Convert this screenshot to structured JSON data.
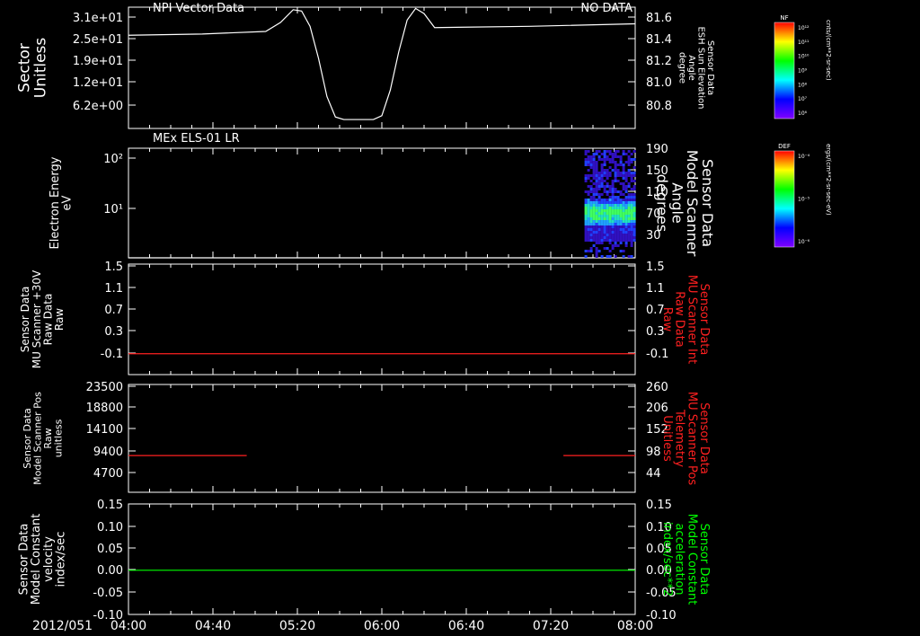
{
  "chart_data": [
    {
      "type": "line",
      "title": "NPI Vector Data",
      "status": "NO DATA",
      "ylabel_left": [
        "Sector",
        "Unitless"
      ],
      "ylabel_right": [
        "Sensor Data",
        "ESH Sun Elevation",
        "Angle",
        "degree"
      ],
      "yticks_left": [
        "3.1e+01",
        "2.5e+01",
        "1.9e+01",
        "1.2e+01",
        "6.2e+00"
      ],
      "yticks_right": [
        "81.6",
        "81.4",
        "81.2",
        "81.0",
        "80.8"
      ],
      "ylim_right": [
        80.65,
        81.6
      ],
      "color": "#ffffff",
      "series": [
        {
          "axis": "right",
          "points": [
            [
              0,
              81.38
            ],
            [
              35,
              81.39
            ],
            [
              65,
              81.41
            ],
            [
              72,
              81.48
            ],
            [
              78,
              81.58
            ],
            [
              82,
              81.57
            ],
            [
              86,
              81.45
            ],
            [
              90,
              81.2
            ],
            [
              94,
              80.9
            ],
            [
              98,
              80.74
            ],
            [
              102,
              80.72
            ],
            [
              116,
              80.72
            ],
            [
              120,
              80.75
            ],
            [
              124,
              80.95
            ],
            [
              128,
              81.25
            ],
            [
              132,
              81.5
            ],
            [
              136,
              81.59
            ],
            [
              140,
              81.55
            ],
            [
              145,
              81.44
            ],
            [
              190,
              81.45
            ],
            [
              240,
              81.47
            ]
          ]
        }
      ]
    },
    {
      "type": "heatmap",
      "title": "MEx ELS-01 LR",
      "ylabel_left": [
        "Electron Energy",
        "eV"
      ],
      "ylabel_right": [
        "Sensor Data",
        "Model Scanner",
        "Angle",
        "degrees"
      ],
      "yticks_left": [
        "10²",
        "10¹"
      ],
      "yticks_right": [
        "190",
        "150",
        "110",
        "70",
        "30"
      ],
      "ylim_right": [
        10,
        190
      ],
      "scanner_angle": 10,
      "data_start_min": 216,
      "color": "#ffffff"
    },
    {
      "type": "line",
      "ylabel_left": [
        "Sensor Data",
        "MU Scanner +30V",
        "Raw Data",
        "Raw"
      ],
      "ylabel_right": [
        "Sensor Data",
        "MU Scanner Int",
        "Raw Data",
        "Raw"
      ],
      "yticks_left": [
        "1.5",
        "1.1",
        "0.7",
        "0.3",
        "-0.1"
      ],
      "yticks_right": [
        "1.5",
        "1.1",
        "0.7",
        "0.3",
        "-0.1"
      ],
      "ylim": [
        -0.35,
        1.5
      ],
      "right_label_color": "#ff2020",
      "color": "#ff2020",
      "series": [
        {
          "axis": "right",
          "points": [
            [
              0,
              0.0
            ],
            [
              240,
              0.0
            ]
          ]
        }
      ]
    },
    {
      "type": "line",
      "ylabel_left": [
        "Sensor Data",
        "Model Scanner Pos",
        "Raw",
        "unitless"
      ],
      "ylabel_right": [
        "Sensor Data",
        "MU Scanner Pos",
        "Telemetry",
        "Unitless"
      ],
      "yticks_left": [
        "23500",
        "18800",
        "14100",
        "9400",
        "4700"
      ],
      "yticks_right": [
        "260",
        "206",
        "152",
        "98",
        "44"
      ],
      "ylim_left": [
        0,
        23500
      ],
      "right_label_color": "#ff2020",
      "color": "#ff2020",
      "series": [
        {
          "axis": "left",
          "points": [
            [
              0,
              8000
            ],
            [
              56,
              8000
            ]
          ]
        },
        {
          "axis": "left",
          "points": [
            [
              206,
              8000
            ],
            [
              240,
              8000
            ]
          ]
        }
      ]
    },
    {
      "type": "line",
      "ylabel_left": [
        "Sensor Data",
        "Model Constant",
        "velocity",
        "index/sec"
      ],
      "ylabel_right": [
        "Sensor Data",
        "Model Constant",
        "acceleration",
        "index/sec**2"
      ],
      "yticks_left": [
        "0.15",
        "0.10",
        "0.05",
        "0.00",
        "-0.05",
        "-0.10"
      ],
      "yticks_right": [
        "0.15",
        "0.10",
        "0.05",
        "0.00",
        "-0.05",
        "-0.10"
      ],
      "ylim": [
        -0.1,
        0.15
      ],
      "right_label_color": "#00ff00",
      "color": "#00ff00",
      "series": [
        {
          "axis": "left",
          "points": [
            [
              0,
              0.0
            ],
            [
              240,
              0.0
            ]
          ]
        }
      ]
    }
  ],
  "time_axis": {
    "date": "2012/051",
    "ticks": [
      "04:00",
      "04:40",
      "05:20",
      "06:00",
      "06:40",
      "07:20",
      "08:00"
    ],
    "xlim_minutes": [
      0,
      240
    ]
  },
  "colorbars": [
    {
      "label": "NF",
      "units": "cnts/(cm**2-sr-sec)",
      "ticks": [
        "10¹²",
        "10¹¹",
        "10¹⁰",
        "10⁹",
        "10⁸",
        "10⁷",
        "10⁶"
      ]
    },
    {
      "label": "DEF",
      "units": "ergs/(cm**2-sr-sec-eV)",
      "ticks": [
        "10⁻⁴",
        "10⁻⁵",
        "10⁻⁶"
      ]
    }
  ]
}
